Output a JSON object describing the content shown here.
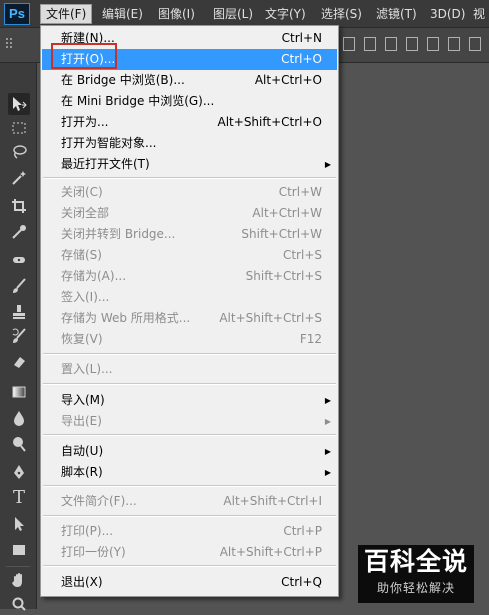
{
  "app": {
    "logo": "Ps"
  },
  "menubar": {
    "items": [
      {
        "label": "文件(F)",
        "active": true
      },
      {
        "label": "编辑(E)"
      },
      {
        "label": "图像(I)"
      },
      {
        "label": "图层(L)"
      },
      {
        "label": "文字(Y)"
      },
      {
        "label": "选择(S)"
      },
      {
        "label": "滤镜(T)"
      },
      {
        "label": "3D(D)"
      },
      {
        "label": "视"
      }
    ]
  },
  "file_menu": {
    "items": [
      {
        "label": "新建(N)...",
        "shortcut": "Ctrl+N",
        "enabled": true
      },
      {
        "label": "打开(O)...",
        "shortcut": "Ctrl+O",
        "enabled": true,
        "highlighted": true
      },
      {
        "label": "在 Bridge 中浏览(B)...",
        "shortcut": "Alt+Ctrl+O",
        "enabled": true
      },
      {
        "label": "在 Mini Bridge 中浏览(G)...",
        "shortcut": "",
        "enabled": true
      },
      {
        "label": "打开为...",
        "shortcut": "Alt+Shift+Ctrl+O",
        "enabled": true
      },
      {
        "label": "打开为智能对象...",
        "shortcut": "",
        "enabled": true
      },
      {
        "label": "最近打开文件(T)",
        "shortcut": "",
        "enabled": true,
        "submenu": true
      },
      {
        "label": "关闭(C)",
        "shortcut": "Ctrl+W",
        "enabled": false
      },
      {
        "label": "关闭全部",
        "shortcut": "Alt+Ctrl+W",
        "enabled": false
      },
      {
        "label": "关闭并转到 Bridge...",
        "shortcut": "Shift+Ctrl+W",
        "enabled": false
      },
      {
        "label": "存储(S)",
        "shortcut": "Ctrl+S",
        "enabled": false
      },
      {
        "label": "存储为(A)...",
        "shortcut": "Shift+Ctrl+S",
        "enabled": false
      },
      {
        "label": "签入(I)...",
        "shortcut": "",
        "enabled": false
      },
      {
        "label": "存储为 Web 所用格式...",
        "shortcut": "Alt+Shift+Ctrl+S",
        "enabled": false
      },
      {
        "label": "恢复(V)",
        "shortcut": "F12",
        "enabled": false
      },
      {
        "label": "置入(L)...",
        "shortcut": "",
        "enabled": false
      },
      {
        "label": "导入(M)",
        "shortcut": "",
        "enabled": true,
        "submenu": true
      },
      {
        "label": "导出(E)",
        "shortcut": "",
        "enabled": false,
        "submenu": true
      },
      {
        "label": "自动(U)",
        "shortcut": "",
        "enabled": true,
        "submenu": true
      },
      {
        "label": "脚本(R)",
        "shortcut": "",
        "enabled": true,
        "submenu": true
      },
      {
        "label": "文件简介(F)...",
        "shortcut": "Alt+Shift+Ctrl+I",
        "enabled": false
      },
      {
        "label": "打印(P)...",
        "shortcut": "Ctrl+P",
        "enabled": false
      },
      {
        "label": "打印一份(Y)",
        "shortcut": "Alt+Shift+Ctrl+P",
        "enabled": false
      },
      {
        "label": "退出(X)",
        "shortcut": "Ctrl+Q",
        "enabled": true
      }
    ]
  },
  "tools": [
    "move-tool-icon",
    "marquee-tool-icon",
    "lasso-tool-icon",
    "magic-wand-tool-icon",
    "crop-tool-icon",
    "eyedropper-tool-icon",
    "healing-brush-tool-icon",
    "brush-tool-icon",
    "clone-stamp-tool-icon",
    "history-brush-tool-icon",
    "eraser-tool-icon",
    "gradient-tool-icon",
    "blur-tool-icon",
    "dodge-tool-icon",
    "pen-tool-icon",
    "type-tool-icon",
    "path-selection-tool-icon",
    "rectangle-tool-icon",
    "hand-tool-icon",
    "zoom-tool-icon"
  ],
  "watermark": {
    "title": "百科全说",
    "subtitle": "助你轻松解决"
  },
  "colors": {
    "highlight": "#3399ff",
    "menu_bg": "#f0f0f0",
    "app_bg": "#535353",
    "annotation_box": "#c4322a"
  }
}
